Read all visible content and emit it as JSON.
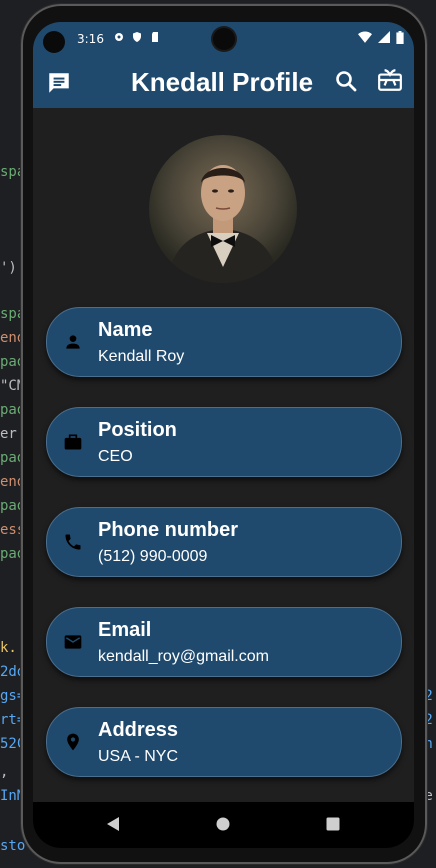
{
  "status_bar": {
    "time": "3:16"
  },
  "app_bar": {
    "title": "Knedall Profile"
  },
  "cards": [
    {
      "label": "Name",
      "value": "Kendall Roy",
      "icon": "person-icon"
    },
    {
      "label": "Position",
      "value": "CEO",
      "icon": "briefcase-icon"
    },
    {
      "label": "Phone number",
      "value": "(512) 990-0009",
      "icon": "phone-icon"
    },
    {
      "label": "Email",
      "value": "kendall_roy@gmail.com",
      "icon": "mail-icon"
    },
    {
      "label": "Address",
      "value": "USA - NYC",
      "icon": "location-pin-icon"
    }
  ],
  "colors": {
    "primary": "#1f4a6e",
    "background": "#1f1f1f",
    "text": "#ffffff"
  }
}
